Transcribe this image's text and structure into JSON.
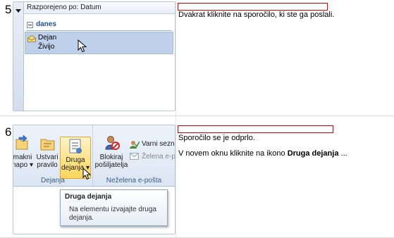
{
  "steps": [
    {
      "number": "5",
      "instruction": "Dvakrat kliknite na sporočilo, ki ste ga poslali.",
      "panel": {
        "arrange_header": "Razporejeno po: Datum",
        "group_label": "danes",
        "message": {
          "sender": "Dejan",
          "subject": "Živijo"
        }
      }
    },
    {
      "number": "6",
      "instruction_line1": "Sporočilo se je odprlo.",
      "instruction_line2_prefix": "V novem oknu kliknite na ikono ",
      "instruction_line2_bold": "Druga dejanja",
      "instruction_line2_suffix": " ...",
      "ribbon": {
        "buttons": [
          {
            "line1": "makni",
            "line2": "napo ▾"
          },
          {
            "line1": "Ustvari",
            "line2": "pravilo"
          },
          {
            "line1": "Druga",
            "line2": "dejanja ▾"
          },
          {
            "line1": "Blokiraj",
            "line2": "pošiljatelja"
          }
        ],
        "small_buttons": [
          "Varni sezn",
          "Želena e-pošta"
        ],
        "group_labels": [
          "Dejanja",
          "Neželena e-pošta"
        ]
      },
      "tooltip": {
        "title": "Druga dejanja",
        "body_line1": "Na elementu izvajajte druga",
        "body_line2": "dejanja."
      }
    }
  ]
}
